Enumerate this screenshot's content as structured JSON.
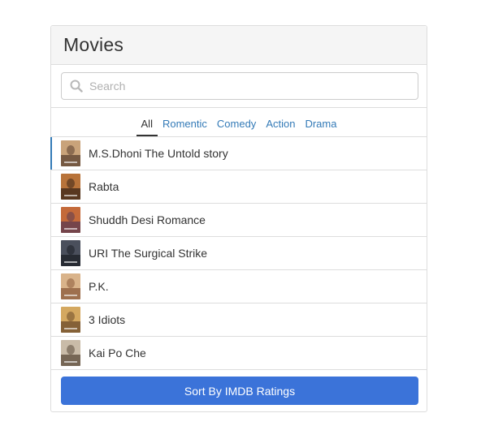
{
  "panel": {
    "title": "Movies"
  },
  "search": {
    "placeholder": "Search",
    "value": "",
    "icon": "search-icon"
  },
  "tabs": [
    {
      "label": "All",
      "active": true
    },
    {
      "label": "Romentic",
      "active": false
    },
    {
      "label": "Comedy",
      "active": false
    },
    {
      "label": "Action",
      "active": false
    },
    {
      "label": "Drama",
      "active": false
    }
  ],
  "movies": [
    {
      "name": "M.S.Dhoni The Untold story",
      "poster_colors": [
        "#c9a37a",
        "#5a4030"
      ]
    },
    {
      "name": "Rabta",
      "poster_colors": [
        "#b8733a",
        "#3a2418"
      ]
    },
    {
      "name": "Shuddh Desi Romance",
      "poster_colors": [
        "#c46a3a",
        "#5b3a52"
      ]
    },
    {
      "name": "URI The Surgical Strike",
      "poster_colors": [
        "#4a4f5c",
        "#1c1f26"
      ]
    },
    {
      "name": "P.K.",
      "poster_colors": [
        "#d9b38a",
        "#8a5a3a"
      ]
    },
    {
      "name": "3 Idiots",
      "poster_colors": [
        "#d4a860",
        "#6b4a2a"
      ]
    },
    {
      "name": "Kai Po Che",
      "poster_colors": [
        "#c9bba8",
        "#5a4a3a"
      ]
    }
  ],
  "footer": {
    "sort_label": "Sort By IMDB Ratings"
  },
  "colors": {
    "accent": "#337ab7",
    "button": "#3b73d9"
  }
}
